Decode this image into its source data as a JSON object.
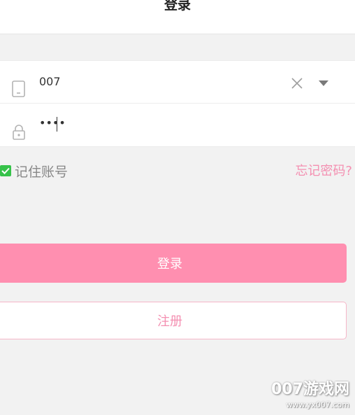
{
  "header": {
    "title": "登录"
  },
  "account": {
    "value": "007"
  },
  "password": {
    "masked_value": "••••"
  },
  "remember": {
    "label": "记住账号",
    "checked": true
  },
  "forgot": {
    "label": "忘记密码?"
  },
  "actions": {
    "login_label": "登录",
    "register_label": "注册"
  },
  "watermark": {
    "title": "007游戏网",
    "url": "www.yx007.com"
  },
  "colors": {
    "accent_pink": "#ff8fb0",
    "link_pink": "#f48fb1",
    "checkbox_green": "#36c24a",
    "background": "#f2f2f2"
  },
  "icons": {
    "account": "phone-icon",
    "password": "lock-icon",
    "clear": "close-icon",
    "dropdown": "caret-down-icon",
    "checkbox": "checkmark-icon"
  }
}
